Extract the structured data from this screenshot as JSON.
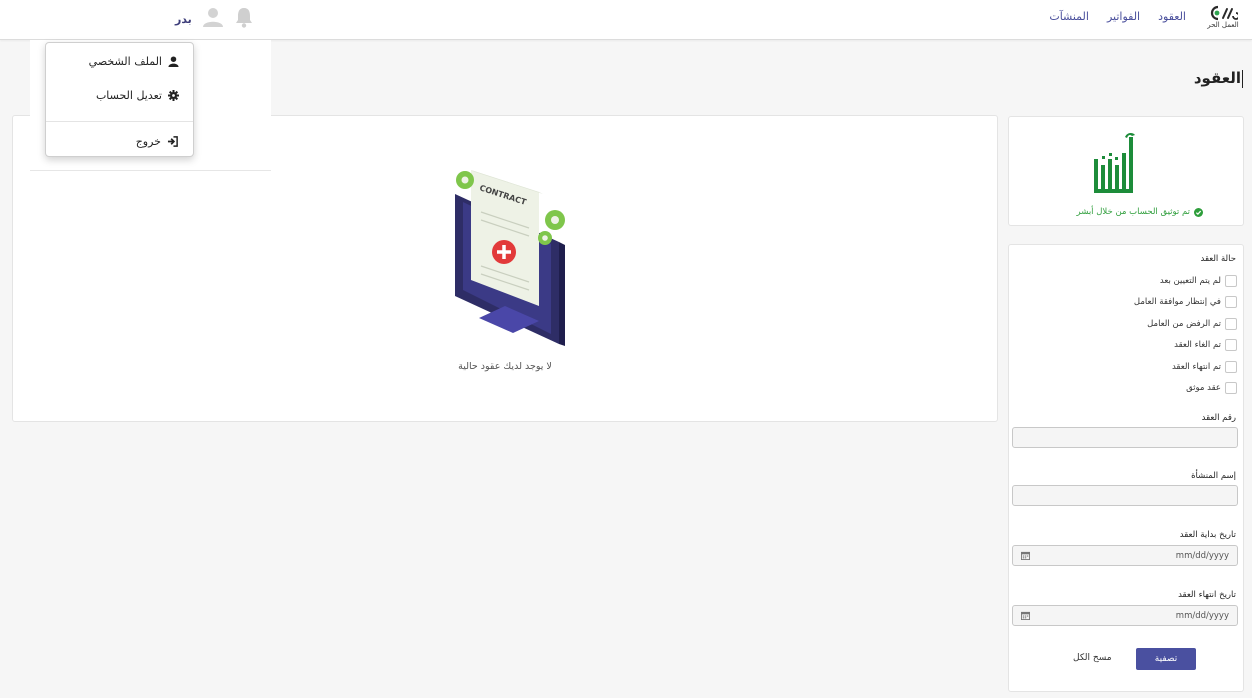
{
  "nav": {
    "brand_name": "العمل الحر",
    "links": [
      "العقود",
      "الفواتير",
      "المنشآت"
    ],
    "user_name": "بدر"
  },
  "user_menu": {
    "profile": "الملف الشخصي",
    "edit_account": "تعديل الحساب",
    "logout": "خروج"
  },
  "page": {
    "title": "العقود"
  },
  "verification": {
    "status_text": "تم توثيق الحساب من خلال أبشر"
  },
  "filters": {
    "status_title": "حالة العقد",
    "statuses": [
      "لم يتم التعيين بعد",
      "في إنتظار موافقة العامل",
      "تم الرفض من العامل",
      "تم الغاء العقد",
      "تم انتهاء العقد",
      "عقد موثق"
    ],
    "contract_number_label": "رقم العقد",
    "contract_number_value": "",
    "facility_name_label": "إسم المنشأة",
    "facility_name_value": "",
    "start_date_label": "تاريخ بداية العقد",
    "start_date_placeholder": "mm/dd/yyyy",
    "end_date_label": "تاريخ انتهاء العقد",
    "end_date_placeholder": "mm/dd/yyyy",
    "filter_button": "تصفية",
    "clear_all": "مسح الكل"
  },
  "contracts": {
    "illustration_label": "CONTRACT",
    "empty_message": "لا يوجد لديك عقود حالية"
  },
  "colors": {
    "primary": "#4a50a0",
    "success": "#2e9e3b",
    "absher_green": "#1d8c3a"
  }
}
